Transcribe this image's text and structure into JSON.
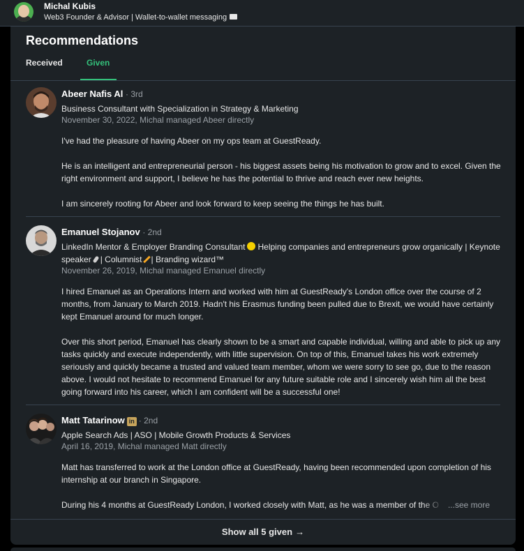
{
  "topbar": {
    "name": "Michal Kubis",
    "headline": "Web3 Founder & Advisor | Wallet-to-wallet messaging",
    "headline_icon": "envelope-icon"
  },
  "section": {
    "title": "Recommendations",
    "tabs": [
      {
        "label": "Received",
        "active": false
      },
      {
        "label": "Given",
        "active": true
      }
    ]
  },
  "recommendations": [
    {
      "name": "Abeer Nafis Al",
      "degree": "· 3rd",
      "headline": "Business Consultant with Specialization in Strategy & Marketing",
      "meta": "November 30, 2022, Michal managed Abeer directly",
      "paragraphs": [
        "I've had the pleasure of having Abeer on my ops team at GuestReady.",
        "He is an intelligent and entrepreneurial person - his biggest assets being his motivation to grow and to excel. Given the right environment and support, I believe he has the potential to thrive and reach ever new heights.",
        "I am sincerely rooting for Abeer and look forward to keep seeing the things he has built."
      ]
    },
    {
      "name": "Emanuel Stojanov",
      "degree": "· 2nd",
      "headline_parts": [
        "LinkedIn Mentor & Employer Branding Consultant",
        "Helping companies and entrepreneurs grow organically | Keynote speaker",
        "| Columnist",
        "| Branding wizard™"
      ],
      "meta": "November 26, 2019, Michal managed Emanuel directly",
      "paragraphs": [
        "I hired Emanuel as an Operations Intern and worked with him at GuestReady's London office over the course of 2 months, from January to March 2019. Hadn't his Erasmus funding been pulled due to Brexit, we would have certainly kept Emanuel around for much longer.",
        "Over this short period, Emanuel has clearly shown to be a smart and capable individual, willing and able to pick up any tasks quickly and execute independently, with little supervision. On top of this, Emanuel takes his work extremely seriously and quickly became a trusted and valued team member, whom we were sorry to see go, due to the reason above. I would not hesitate to recommend Emanuel for any future suitable role and I sincerely wish him all the best going forward into his career, which I am confident will be a successful one!"
      ]
    },
    {
      "name": "Matt Tatarinow",
      "badge": "in",
      "degree": "· 2nd",
      "headline": "Apple Search Ads | ASO | Mobile Growth Products & Services",
      "meta": "April 16, 2019, Michal managed Matt directly",
      "paragraphs": [
        "Matt has transferred to work at the London office at GuestReady, having been recommended upon completion of his internship at our branch in Singapore.",
        "During his 4 months at GuestReady London, I worked closely with Matt, as he was a member of the O"
      ],
      "see_more": "...see more"
    }
  ],
  "show_all": {
    "label": "Show all 5 given",
    "icon": "arrow-right-icon"
  },
  "colors": {
    "background": "#000000",
    "card": "#1d2226",
    "accent_green": "#34c17b",
    "muted": "#9aa0a6",
    "divider": "#38434f"
  }
}
